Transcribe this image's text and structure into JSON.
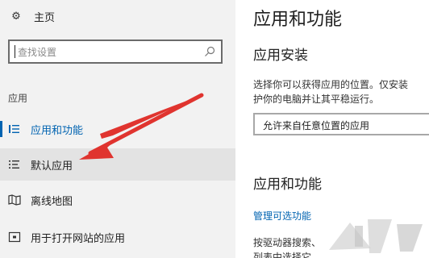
{
  "sidebar": {
    "home_label": "主页",
    "search_placeholder": "查找设置",
    "section_label": "应用",
    "items": [
      {
        "label": "应用和功能",
        "icon": "list-icon"
      },
      {
        "label": "默认应用",
        "icon": "default-apps-icon"
      },
      {
        "label": "离线地图",
        "icon": "map-icon"
      },
      {
        "label": "用于打开网站的应用",
        "icon": "website-app-icon"
      }
    ]
  },
  "main": {
    "title": "应用和功能",
    "install_heading": "应用安装",
    "install_desc_line1": "选择你可以获得应用的位置。仅安装",
    "install_desc_line2": "护你的电脑并让其平稳运行。",
    "install_dropdown_value": "允许来自任意位置的应用",
    "apps_heading": "应用和功能",
    "manage_optional_link": "管理可选功能",
    "apps_desc_line1": "按驱动器搜索、",
    "apps_desc_line2": "列表中选择它"
  },
  "colors": {
    "accent": "#0063b1",
    "sidebar_bg": "#f2f2f2",
    "selected_bg": "#e3e3e3",
    "arrow": "#e0342f"
  }
}
